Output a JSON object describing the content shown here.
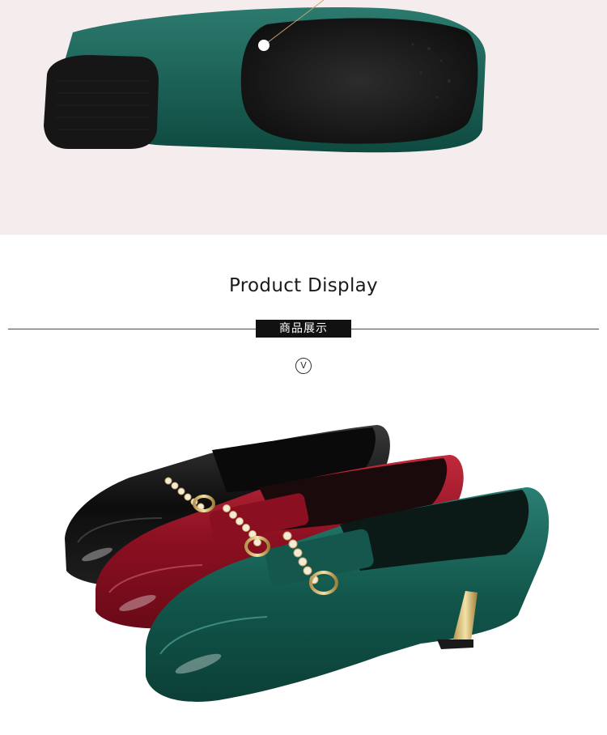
{
  "section": {
    "title": "Product Display",
    "badge": "商品展示",
    "marker": "V"
  },
  "colors": {
    "top_background": "#f5eced",
    "green_shoe": "#145a4f",
    "red_shoe": "#9c1326",
    "black_shoe": "#141414",
    "badge_background": "#111111"
  }
}
